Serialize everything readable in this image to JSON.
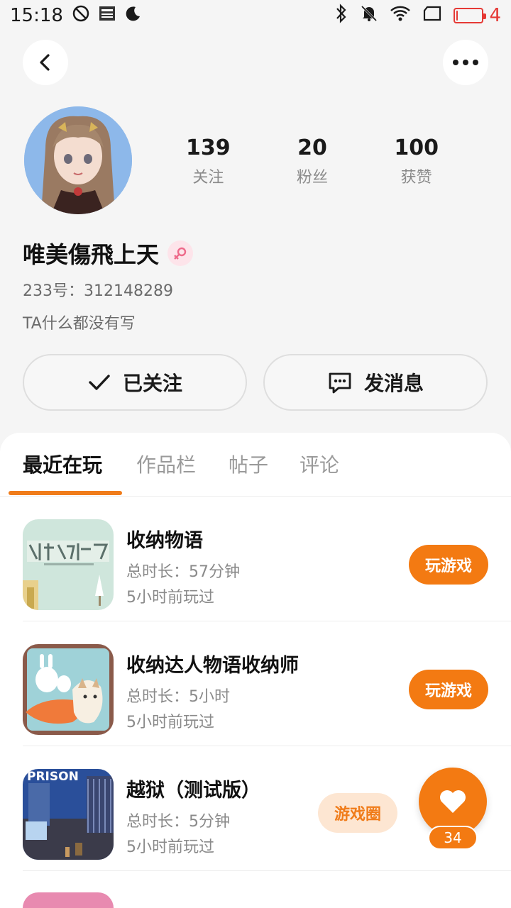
{
  "status_bar": {
    "time": "15:18",
    "battery_level": "4",
    "battery_fraction": 0.04
  },
  "profile": {
    "stats": [
      {
        "value": "139",
        "label": "关注"
      },
      {
        "value": "20",
        "label": "粉丝"
      },
      {
        "value": "100",
        "label": "获赞"
      }
    ],
    "username": "唯美傷飛上天",
    "uid": "233号：312148289",
    "bio": "TA什么都没有写",
    "follow_label": "已关注",
    "message_label": "发消息"
  },
  "tabs": [
    {
      "label": "最近在玩",
      "active": true
    },
    {
      "label": "作品栏",
      "active": false
    },
    {
      "label": "帖子",
      "active": false
    },
    {
      "label": "评论",
      "active": false
    }
  ],
  "games": [
    {
      "title": "收纳物语",
      "duration": "总时长：57分钟",
      "last_played": "5小时前玩过",
      "action": "玩游戏",
      "icon": "storage-story-game-icon"
    },
    {
      "title": "收纳达人物语收纳师",
      "duration": "总时长：5小时",
      "last_played": "5小时前玩过",
      "action": "玩游戏",
      "icon": "storage-master-game-icon"
    },
    {
      "title": "越狱（测试版）",
      "duration": "总时长：5分钟",
      "last_played": "5小时前玩过",
      "action": "游戏圈",
      "icon": "prison-game-icon"
    }
  ],
  "like_fab": {
    "count": "34"
  },
  "colors": {
    "accent": "#f37a12",
    "accent_light": "#fde6d2",
    "background": "#f5f5f5"
  }
}
